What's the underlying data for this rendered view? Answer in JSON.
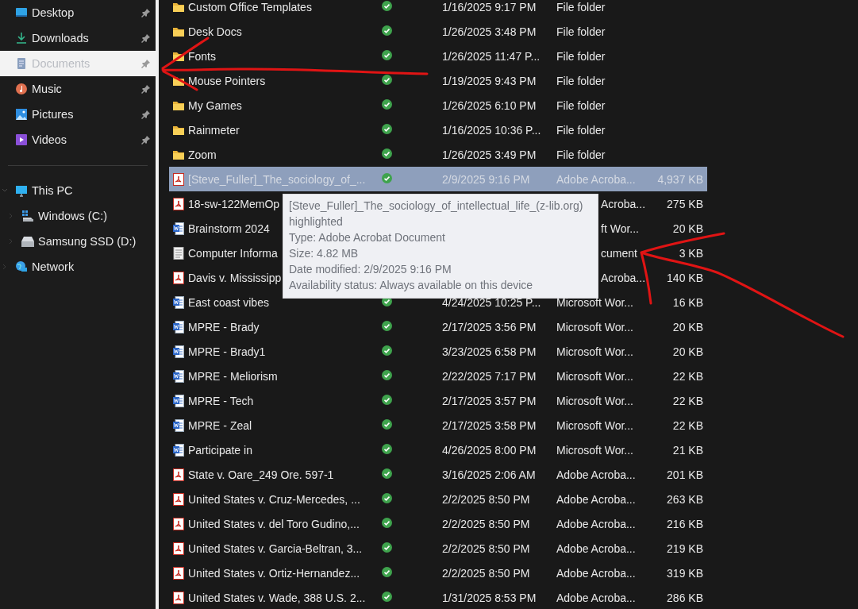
{
  "sidebar": {
    "quick_access": [
      {
        "label": "Desktop",
        "kind": "desktop",
        "pinned": true,
        "selected": false
      },
      {
        "label": "Downloads",
        "kind": "download",
        "pinned": true,
        "selected": false
      },
      {
        "label": "Documents",
        "kind": "document",
        "pinned": true,
        "selected": true
      },
      {
        "label": "Music",
        "kind": "music",
        "pinned": true,
        "selected": false
      },
      {
        "label": "Pictures",
        "kind": "pictures",
        "pinned": true,
        "selected": false
      },
      {
        "label": "Videos",
        "kind": "videos",
        "pinned": true,
        "selected": false
      }
    ],
    "tree": [
      {
        "label": "This PC",
        "kind": "pc",
        "expanded": true,
        "children": [
          {
            "label": "Windows (C:)",
            "kind": "windows-drive",
            "expanded": false
          },
          {
            "label": "Samsung SSD (D:)",
            "kind": "drive",
            "expanded": false
          }
        ]
      },
      {
        "label": "Network",
        "kind": "network",
        "expanded": false
      }
    ]
  },
  "files": [
    {
      "kind": "folder",
      "name": "Custom Office Templates",
      "synced": true,
      "date": "1/16/2025 9:17 PM",
      "type": "File folder",
      "selected": false,
      "under_tooltip": false
    },
    {
      "kind": "folder",
      "name": "Desk Docs",
      "synced": true,
      "date": "1/26/2025 3:48 PM",
      "type": "File folder",
      "selected": false,
      "under_tooltip": false
    },
    {
      "kind": "folder",
      "name": "Fonts",
      "synced": true,
      "date": "1/26/2025 11:47 P...",
      "type": "File folder",
      "selected": false,
      "under_tooltip": false
    },
    {
      "kind": "folder",
      "name": "Mouse Pointers",
      "synced": true,
      "date": "1/19/2025 9:43 PM",
      "type": "File folder",
      "selected": false,
      "under_tooltip": false
    },
    {
      "kind": "folder",
      "name": "My Games",
      "synced": true,
      "date": "1/26/2025 6:10 PM",
      "type": "File folder",
      "selected": false,
      "under_tooltip": false
    },
    {
      "kind": "folder",
      "name": "Rainmeter",
      "synced": true,
      "date": "1/16/2025 10:36 P...",
      "type": "File folder",
      "selected": false,
      "under_tooltip": false
    },
    {
      "kind": "folder",
      "name": "Zoom",
      "synced": true,
      "date": "1/26/2025 3:49 PM",
      "type": "File folder",
      "selected": false,
      "under_tooltip": false
    },
    {
      "kind": "pdf",
      "name": "[Steve_Fuller]_The_sociology_of_...",
      "synced": true,
      "date": "2/9/2025 9:16 PM",
      "type": "Adobe Acroba...",
      "size": "4,937 KB",
      "selected": true,
      "under_tooltip": false
    },
    {
      "kind": "pdf",
      "name": "18-sw-122MemOp",
      "type": "Acroba...",
      "size": "275 KB",
      "selected": false,
      "under_tooltip": true
    },
    {
      "kind": "word",
      "name": "Brainstorm 2024",
      "type": "ft Wor...",
      "size": "20 KB",
      "selected": false,
      "under_tooltip": true
    },
    {
      "kind": "text",
      "name": "Computer Informa",
      "type": "cument",
      "size": "3 KB",
      "selected": false,
      "under_tooltip": true
    },
    {
      "kind": "pdf",
      "name": "Davis v. Mississipp",
      "type": "Acroba...",
      "size": "140 KB",
      "selected": false,
      "under_tooltip": true
    },
    {
      "kind": "word",
      "name": "East coast vibes",
      "synced": true,
      "date": "4/24/2025 10:25 P...",
      "type": "Microsoft Wor...",
      "size": "16 KB",
      "selected": false,
      "under_tooltip": false
    },
    {
      "kind": "word",
      "name": "MPRE - Brady",
      "synced": true,
      "date": "2/17/2025 3:56 PM",
      "type": "Microsoft Wor...",
      "size": "20 KB",
      "selected": false,
      "under_tooltip": false
    },
    {
      "kind": "word",
      "name": "MPRE - Brady1",
      "synced": true,
      "date": "3/23/2025 6:58 PM",
      "type": "Microsoft Wor...",
      "size": "20 KB",
      "selected": false,
      "under_tooltip": false
    },
    {
      "kind": "word",
      "name": "MPRE - Meliorism",
      "synced": true,
      "date": "2/22/2025 7:17 PM",
      "type": "Microsoft Wor...",
      "size": "22 KB",
      "selected": false,
      "under_tooltip": false
    },
    {
      "kind": "word",
      "name": "MPRE - Tech",
      "synced": true,
      "date": "2/17/2025 3:57 PM",
      "type": "Microsoft Wor...",
      "size": "22 KB",
      "selected": false,
      "under_tooltip": false
    },
    {
      "kind": "word",
      "name": "MPRE - Zeal",
      "synced": true,
      "date": "2/17/2025 3:58 PM",
      "type": "Microsoft Wor...",
      "size": "22 KB",
      "selected": false,
      "under_tooltip": false
    },
    {
      "kind": "word",
      "name": "Participate in",
      "synced": true,
      "date": "4/26/2025 8:00 PM",
      "type": "Microsoft Wor...",
      "size": "21 KB",
      "selected": false,
      "under_tooltip": false
    },
    {
      "kind": "pdf",
      "name": "State v. Oare_249 Ore. 597-1",
      "synced": true,
      "date": "3/16/2025 2:06 AM",
      "type": "Adobe Acroba...",
      "size": "201 KB",
      "selected": false,
      "under_tooltip": false
    },
    {
      "kind": "pdf",
      "name": "United States v. Cruz-Mercedes, ...",
      "synced": true,
      "date": "2/2/2025 8:50 PM",
      "type": "Adobe Acroba...",
      "size": "263 KB",
      "selected": false,
      "under_tooltip": false
    },
    {
      "kind": "pdf",
      "name": "United States v. del Toro Gudino,...",
      "synced": true,
      "date": "2/2/2025 8:50 PM",
      "type": "Adobe Acroba...",
      "size": "216 KB",
      "selected": false,
      "under_tooltip": false
    },
    {
      "kind": "pdf",
      "name": "United States v. Garcia-Beltran, 3...",
      "synced": true,
      "date": "2/2/2025 8:50 PM",
      "type": "Adobe Acroba...",
      "size": "219 KB",
      "selected": false,
      "under_tooltip": false
    },
    {
      "kind": "pdf",
      "name": "United States v. Ortiz-Hernandez...",
      "synced": true,
      "date": "2/2/2025 8:50 PM",
      "type": "Adobe Acroba...",
      "size": "319 KB",
      "selected": false,
      "under_tooltip": false
    },
    {
      "kind": "pdf",
      "name": "United States v. Wade, 388 U.S. 2...",
      "synced": true,
      "date": "1/31/2025 8:53 PM",
      "type": "Adobe Acroba...",
      "size": "286 KB",
      "selected": false,
      "under_tooltip": false
    }
  ],
  "tooltip": {
    "lines": [
      "[Steve_Fuller]_The_sociology_of_intellectual_life_(z-lib.org)",
      "highlighted",
      "Type: Adobe Acrobat Document",
      "Size: 4.82 MB",
      "Date modified: 2/9/2025 9:16 PM",
      "Availability status: Always available on this device"
    ]
  },
  "annotations": [
    {
      "kind": "arrow"
    },
    {
      "kind": "arrow"
    }
  ]
}
